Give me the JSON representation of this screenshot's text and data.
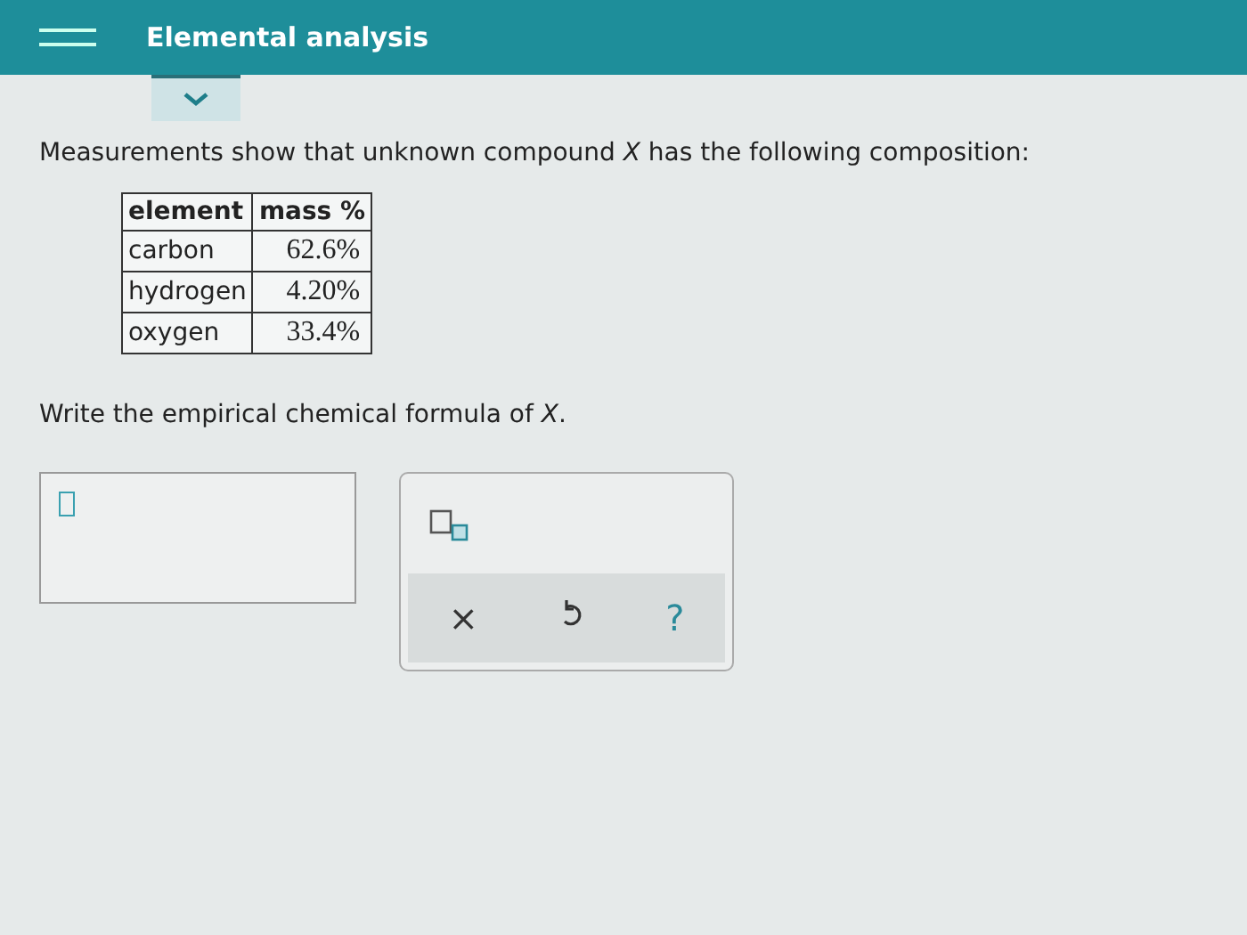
{
  "header": {
    "title": "Elemental analysis"
  },
  "question": "Measurements show that unknown compound *X* has the following composition:",
  "table": {
    "columns": [
      "element",
      "mass %"
    ],
    "rows": [
      [
        "carbon",
        "62.6%"
      ],
      [
        "hydrogen",
        "4.20%"
      ],
      [
        "oxygen",
        "33.4%"
      ]
    ]
  },
  "prompt": "Write the empirical chemical formula of *X*.",
  "palette": {
    "buttons": [
      {
        "kind": "clear",
        "label": "×"
      },
      {
        "kind": "undo"
      },
      {
        "kind": "help",
        "label": "?"
      }
    ]
  }
}
